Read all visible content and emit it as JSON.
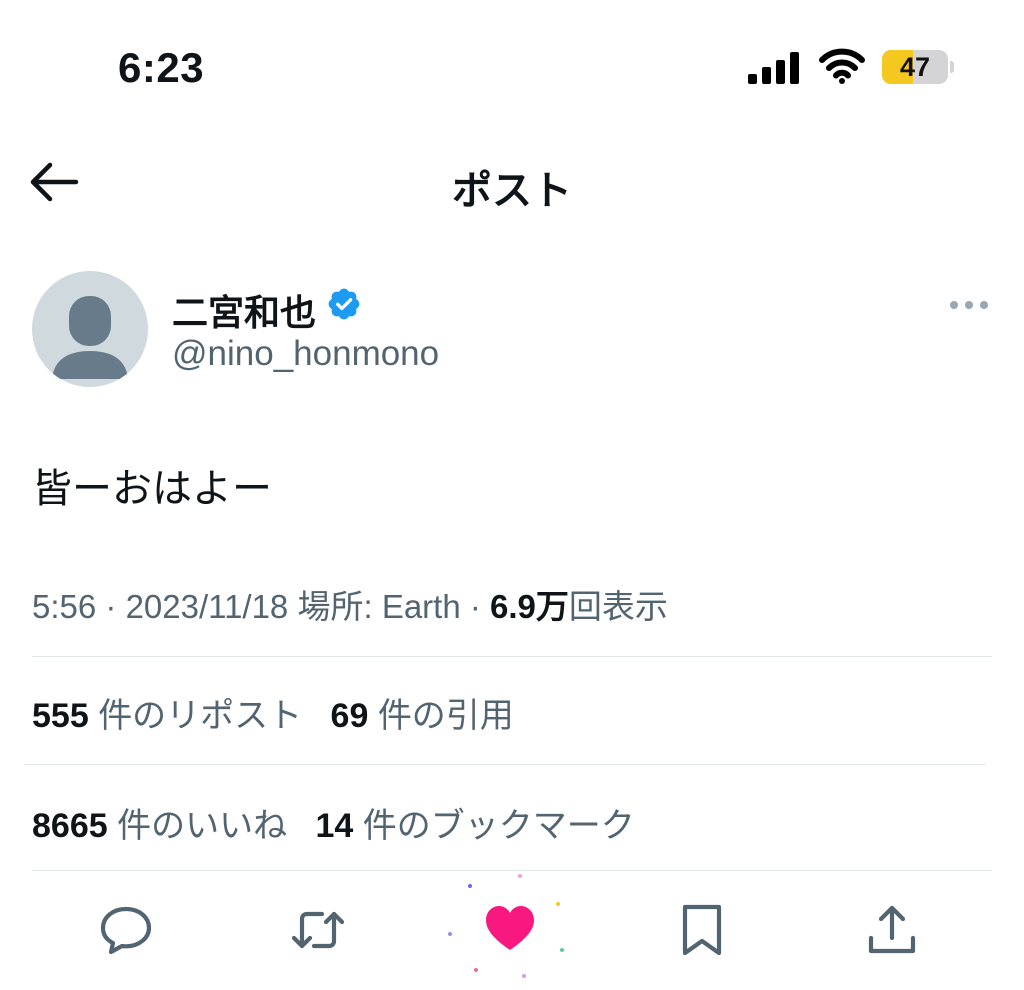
{
  "status_bar": {
    "time": "6:23",
    "battery_level": "47",
    "battery_fill_percent": 47,
    "signal_bars": 4
  },
  "header": {
    "title": "ポスト",
    "back_icon": "arrow-left-icon"
  },
  "author": {
    "display_name": "二宮和也",
    "handle": "@nino_honmono",
    "verified": true,
    "verified_color": "#1d9bf0",
    "avatar": "default-avatar-silhouette"
  },
  "tweet": {
    "text": "皆ーおはよー"
  },
  "meta": {
    "time": "5:56",
    "separator": "·",
    "date": "2023/11/18",
    "location_label": "場所:",
    "location": "Earth",
    "views_count": "6.9万",
    "views_label": "回表示"
  },
  "stats": {
    "reposts_count": "555",
    "reposts_label": "件のリポスト",
    "quotes_count": "69",
    "quotes_label": "件の引用",
    "likes_count": "8665",
    "likes_label": "件のいいね",
    "bookmarks_count": "14",
    "bookmarks_label": "件のブックマーク"
  },
  "actions": {
    "reply_icon": "reply-icon",
    "repost_icon": "repost-icon",
    "like_icon": "heart-icon",
    "like_active": true,
    "like_color": "#f91880",
    "bookmark_icon": "bookmark-icon",
    "share_icon": "share-icon"
  },
  "colors": {
    "text_primary": "#0f1419",
    "text_secondary": "#536471",
    "battery_yellow": "#f4c81e"
  }
}
